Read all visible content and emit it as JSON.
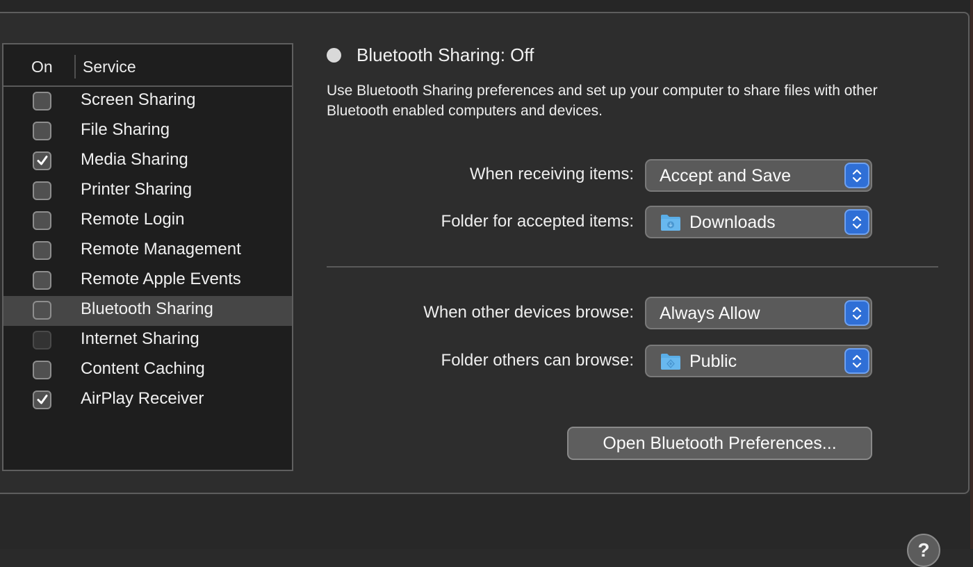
{
  "service_table": {
    "headers": {
      "on": "On",
      "service": "Service"
    },
    "services": [
      {
        "label": "Screen Sharing",
        "checked": false,
        "enabled": true,
        "selected": false
      },
      {
        "label": "File Sharing",
        "checked": false,
        "enabled": true,
        "selected": false
      },
      {
        "label": "Media Sharing",
        "checked": true,
        "enabled": true,
        "selected": false
      },
      {
        "label": "Printer Sharing",
        "checked": false,
        "enabled": true,
        "selected": false
      },
      {
        "label": "Remote Login",
        "checked": false,
        "enabled": true,
        "selected": false
      },
      {
        "label": "Remote Management",
        "checked": false,
        "enabled": true,
        "selected": false
      },
      {
        "label": "Remote Apple Events",
        "checked": false,
        "enabled": true,
        "selected": false
      },
      {
        "label": "Bluetooth Sharing",
        "checked": false,
        "enabled": true,
        "selected": true
      },
      {
        "label": "Internet Sharing",
        "checked": false,
        "enabled": false,
        "selected": false
      },
      {
        "label": "Content Caching",
        "checked": false,
        "enabled": true,
        "selected": false
      },
      {
        "label": "AirPlay Receiver",
        "checked": true,
        "enabled": true,
        "selected": false
      }
    ]
  },
  "detail": {
    "status_title": "Bluetooth Sharing: Off",
    "status_color": "#d9d9d9",
    "description": "Use Bluetooth Sharing preferences and set up your computer to share files with other Bluetooth enabled computers and devices.",
    "fields": {
      "receiving": {
        "label": "When receiving items:",
        "value": "Accept and Save"
      },
      "accepted_folder": {
        "label": "Folder for accepted items:",
        "value": "Downloads",
        "icon": "downloads-folder-icon"
      },
      "browse": {
        "label": "When other devices browse:",
        "value": "Always Allow"
      },
      "browse_folder": {
        "label": "Folder others can browse:",
        "value": "Public",
        "icon": "public-folder-icon"
      }
    },
    "open_prefs_button": "Open Bluetooth Preferences...",
    "help_button": "?"
  },
  "colors": {
    "accent": "#2f6fd6",
    "folder": "#5aaee8"
  }
}
